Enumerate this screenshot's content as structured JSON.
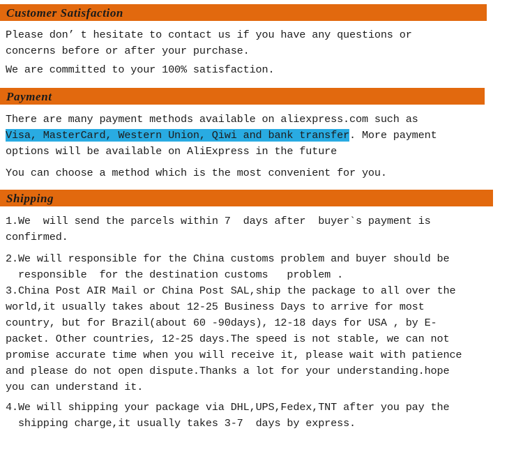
{
  "sections": [
    {
      "id": "customer-satisfaction",
      "title": "Customer Satisfaction",
      "paragraphs": [
        "Please don’ t hesitate to contact us if you have any questions or\nconcerns before or after your purchase.",
        "We are committed to your 100% satisfaction."
      ]
    },
    {
      "id": "payment",
      "title": "Payment",
      "paragraphs": [
        "There are many payment methods available on aliexpress.com such as",
        "Visa, MasterCard, Western Union, Qiwi and bank transfer",
        ". More payment\noptions will be available on AliExpress in the future",
        "You can choose a method which is the most convenient for you."
      ],
      "highlighted_text": "Visa, MasterCard, Western Union, Qiwi and bank transfer"
    },
    {
      "id": "shipping",
      "title": "Shipping",
      "items": [
        {
          "number": "1.",
          "text": "We  will send the parcels within 7  days after  buyer`s payment is\nconfirmed."
        },
        {
          "number": "2.",
          "text": "We will responsible for the China customs problem and buyer should be\n  responsible  for the destination customs   problem ."
        },
        {
          "number": "3.",
          "text": "China Post AIR Mail or China Post SAL,ship the package to all over the\nworld,it usually takes about 12-25 Business Days to arrive for most\ncountry, but for Brazil(about 60 -90days), 12-18 days for USA , by E-\npacket. Other countries, 12-25 days.The speed is not stable, we can not\npromise accurate time when you will receive it, please wait with patience\nand please do not open dispute.Thanks a lot for your understanding.hope\nyou can understand it."
        },
        {
          "number": "4.",
          "text": "We will shipping your package via DHL,UPS,Fedex,TNT after you pay the\n  shipping charge,it usually takes 3-7  days by express."
        }
      ]
    }
  ],
  "colors": {
    "bar_orange": "#e2690e",
    "highlight_cyan": "#29abe2",
    "text": "#1c1c1c",
    "background": "#ffffff"
  }
}
